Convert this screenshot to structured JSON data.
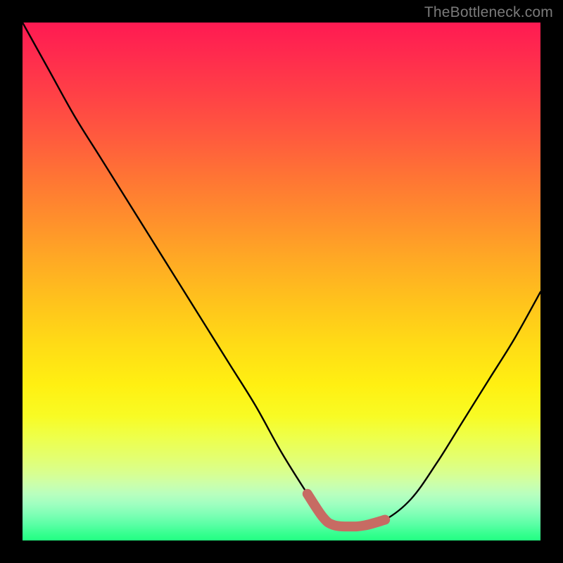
{
  "watermark": "TheBottleneck.com",
  "chart_data": {
    "type": "line",
    "title": "",
    "xlabel": "",
    "ylabel": "",
    "xlim": [
      0,
      100
    ],
    "ylim": [
      0,
      100
    ],
    "grid": false,
    "legend": false,
    "series": [
      {
        "name": "bottleneck-curve",
        "x": [
          0,
          5,
          10,
          15,
          20,
          25,
          30,
          35,
          40,
          45,
          50,
          55,
          58,
          60,
          63,
          66,
          70,
          75,
          80,
          85,
          90,
          95,
          100
        ],
        "values": [
          100,
          91,
          82,
          74,
          66,
          58,
          50,
          42,
          34,
          26,
          17,
          9,
          4.5,
          3.0,
          2.7,
          2.9,
          4.0,
          8,
          15,
          23,
          31,
          39,
          48
        ]
      },
      {
        "name": "optimal-range-highlight",
        "x": [
          55,
          58,
          60,
          63,
          66,
          70
        ],
        "values": [
          9,
          4.5,
          3.0,
          2.7,
          2.9,
          4.0
        ]
      }
    ],
    "colors": {
      "curve": "#000000",
      "highlight": "#c76b63",
      "gradient_top": "#ff1a52",
      "gradient_mid": "#ffdb16",
      "gradient_bottom": "#22ff82"
    }
  }
}
